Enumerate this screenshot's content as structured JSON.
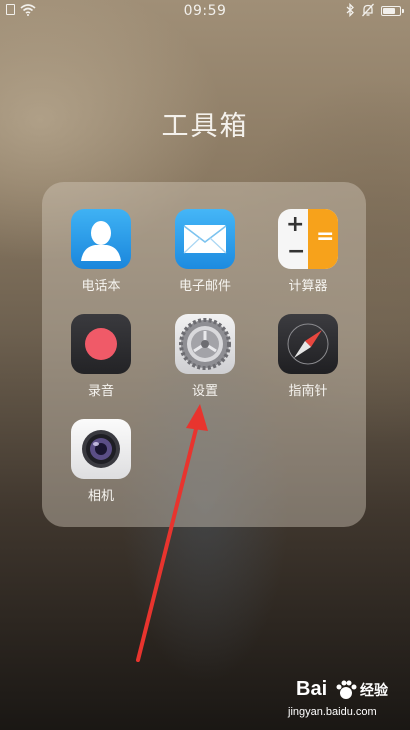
{
  "status_bar": {
    "time": "09:59",
    "battery_level": 0.8,
    "icons": [
      "sim-icon",
      "wifi-icon",
      "bluetooth-icon",
      "mute-icon",
      "battery-icon"
    ]
  },
  "folder": {
    "title": "工具箱",
    "apps": [
      {
        "label": "电话本",
        "icon": "contacts-icon"
      },
      {
        "label": "电子邮件",
        "icon": "mail-icon"
      },
      {
        "label": "计算器",
        "icon": "calculator-icon"
      },
      {
        "label": "录音",
        "icon": "recorder-icon"
      },
      {
        "label": "设置",
        "icon": "settings-icon"
      },
      {
        "label": "指南针",
        "icon": "compass-icon"
      },
      {
        "label": "相机",
        "icon": "camera-icon"
      }
    ]
  },
  "annotation": {
    "color": "#e8342e"
  },
  "watermark": {
    "brand": "Bai",
    "jingyan": "经验",
    "url": "jingyan.baidu.com"
  }
}
